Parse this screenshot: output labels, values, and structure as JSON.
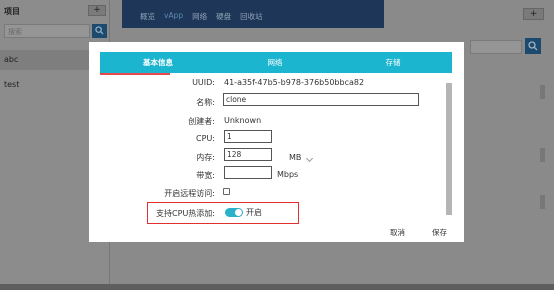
{
  "sidebar": {
    "title": "项目",
    "add_label": "+",
    "search_placeholder": "搜索",
    "items": [
      {
        "label": "abc"
      },
      {
        "label": "test"
      }
    ]
  },
  "topnav": {
    "items": [
      {
        "label": "概览"
      },
      {
        "label": "vApp"
      },
      {
        "label": "网络"
      },
      {
        "label": "硬盘"
      },
      {
        "label": "回收站"
      }
    ]
  },
  "right_panel": {
    "add_label": "+"
  },
  "modal": {
    "tabs": [
      {
        "label": "基本信息"
      },
      {
        "label": "网络"
      },
      {
        "label": "存储"
      }
    ],
    "fields": {
      "uuid_label": "UUID:",
      "uuid_value": "41-a35f-47b5-b978-376b50bbca82",
      "name_label": "名称:",
      "name_value": "clone",
      "creator_label": "创建者:",
      "creator_value": "Unknown",
      "cpu_label": "CPU:",
      "cpu_value": "1",
      "memory_label": "内存:",
      "memory_value": "128",
      "memory_unit": "MB",
      "bandwidth_label": "带宽:",
      "bandwidth_value": "",
      "bandwidth_unit": "Mbps",
      "remote_label": "开启远程访问:",
      "remote_checked": false,
      "hotplug_label": "支持CPU热添加:",
      "hotplug_on": true,
      "hotplug_state": "开启"
    },
    "actions": {
      "cancel": "取消",
      "save": "保存"
    }
  },
  "colors": {
    "tab_bar": "#1cb5cf",
    "tab_active_underline": "#e8474c",
    "toggle_on": "#2bb2c9",
    "highlight_border": "#e0312f",
    "topbar": "#1e3657"
  }
}
